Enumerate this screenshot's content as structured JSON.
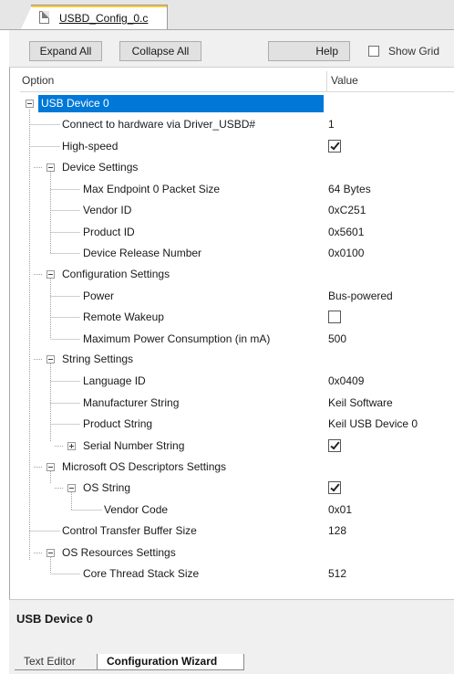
{
  "file_tab": {
    "label": "USBD_Config_0.c"
  },
  "toolbar": {
    "expand_all": "Expand All",
    "collapse_all": "Collapse All",
    "help": "Help",
    "show_grid": "Show Grid"
  },
  "columns": {
    "option": "Option",
    "value": "Value"
  },
  "tree": {
    "usb_device": "USB Device 0",
    "connect": {
      "label": "Connect to hardware via Driver_USBD#",
      "value": "1"
    },
    "high_speed": {
      "label": "High-speed",
      "checked": true
    },
    "device_settings": "Device Settings",
    "max_ep0": {
      "label": "Max Endpoint 0 Packet Size",
      "value": "64 Bytes"
    },
    "vendor_id": {
      "label": "Vendor ID",
      "value": "0xC251"
    },
    "product_id": {
      "label": "Product ID",
      "value": "0x5601"
    },
    "release": {
      "label": "Device Release Number",
      "value": "0x0100"
    },
    "config_settings": "Configuration Settings",
    "power": {
      "label": "Power",
      "value": "Bus-powered"
    },
    "remote_wakeup": {
      "label": "Remote Wakeup",
      "checked": false
    },
    "max_power": {
      "label": "Maximum Power Consumption (in mA)",
      "value": "500"
    },
    "string_settings": "String Settings",
    "language_id": {
      "label": "Language ID",
      "value": "0x0409"
    },
    "manufacturer": {
      "label": "Manufacturer String",
      "value": "Keil Software"
    },
    "product_string": {
      "label": "Product String",
      "value": "Keil USB Device 0"
    },
    "serial": {
      "label": "Serial Number String",
      "checked": true
    },
    "ms_os": "Microsoft OS Descriptors Settings",
    "os_string": {
      "label": "OS String",
      "checked": true
    },
    "vendor_code": {
      "label": "Vendor Code",
      "value": "0x01"
    },
    "ctrl_buffer": {
      "label": "Control Transfer Buffer Size",
      "value": "128"
    },
    "os_resources": "OS Resources Settings",
    "core_thread": {
      "label": "Core Thread Stack Size",
      "value": "512"
    }
  },
  "description": {
    "title": "USB Device 0"
  },
  "bottom_tabs": {
    "text_editor": "Text Editor",
    "config_wizard": "Configuration Wizard"
  },
  "colors": {
    "selection": "#0078d7",
    "tab_accent": "#ffcc33"
  }
}
